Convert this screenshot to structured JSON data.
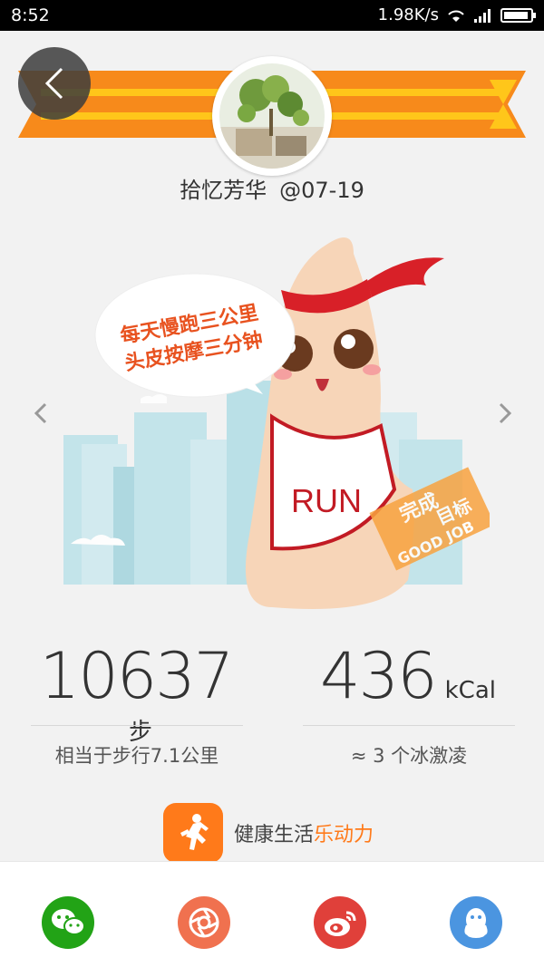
{
  "status": {
    "time": "8:52",
    "network_speed": "1.98K/s"
  },
  "profile": {
    "username": "拾忆芳华",
    "date": "@07-19"
  },
  "illustration": {
    "bubble_line1": "每天慢跑三公里",
    "bubble_line2": "头皮按摩三分钟",
    "shirt_text": "RUN",
    "stamp_line1": "完成",
    "stamp_line2": "目标",
    "stamp_line3": "GOOD JOB"
  },
  "stats": {
    "steps": {
      "value": "10637",
      "unit": "步",
      "note": "相当于步行7.1公里"
    },
    "calories": {
      "value": "436",
      "unit": "kCal",
      "note": "≈ 3 个冰激凌"
    }
  },
  "brand": {
    "name_plain": "健康生活",
    "name_accent": "乐动力"
  },
  "share": [
    {
      "icon": "wechat-icon",
      "color": "#22a316"
    },
    {
      "icon": "moments-icon",
      "color": "#f0714f"
    },
    {
      "icon": "weibo-icon",
      "color": "#e0403a"
    },
    {
      "icon": "qq-icon",
      "color": "#4b95e0"
    }
  ],
  "colors": {
    "accent": "#ff7a1a",
    "ribbon": "#f78a1b",
    "ribbon_light": "#ffc61a"
  }
}
